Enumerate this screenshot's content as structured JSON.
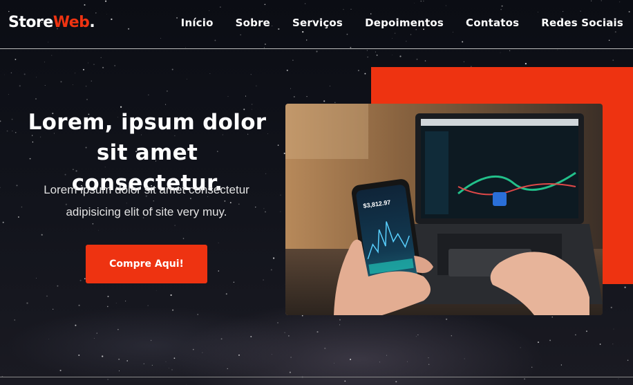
{
  "brand": {
    "name": "Store",
    "accent": "Web",
    "dot": ".",
    "accent_color": "#ee3311"
  },
  "nav": {
    "items": [
      {
        "label": "Início"
      },
      {
        "label": "Sobre"
      },
      {
        "label": "Serviços"
      },
      {
        "label": "Depoimentos"
      },
      {
        "label": "Contatos"
      },
      {
        "label": "Redes Sociais"
      }
    ]
  },
  "hero": {
    "title_line1": "Lorem, ipsum dolor",
    "title_line2": "sit amet consectetur.",
    "subtitle_line1": "Lorem ipsum dolor sit amet consectetur",
    "subtitle_line2": "adipisicing elit of site very muy.",
    "cta_label": "Compre Aqui!",
    "image": "phone-trading-app-photo",
    "phone_price": "$3,812.97"
  },
  "colors": {
    "accent": "#ee3311",
    "background": "#0f1118",
    "text": "#ffffff"
  }
}
